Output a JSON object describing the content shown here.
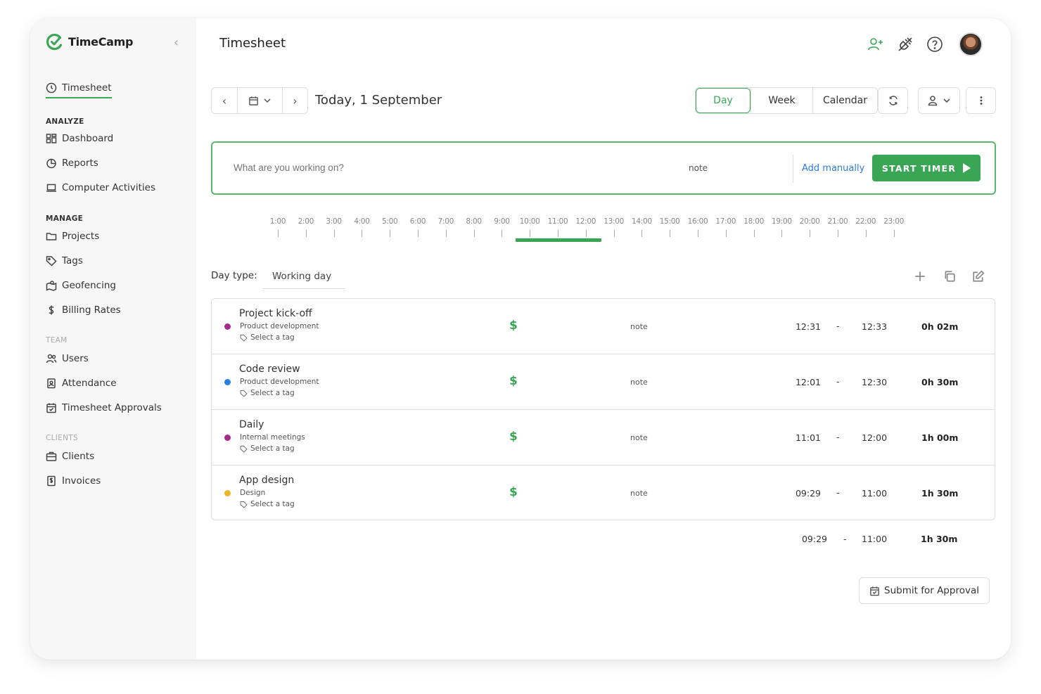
{
  "brand": {
    "name": "TimeCamp",
    "accent": "#3aa655",
    "link_color": "#2a7de1"
  },
  "sidebar": {
    "active_item": "Timesheet",
    "sections": {
      "analyze": "ANALYZE",
      "manage": "MANAGE",
      "team": "TEAM",
      "clients": "CLIENTS"
    },
    "items": {
      "timesheet": "Timesheet",
      "dashboard": "Dashboard",
      "reports": "Reports",
      "computer_activities": "Computer Activities",
      "projects": "Projects",
      "tags": "Tags",
      "geofencing": "Geofencing",
      "billing_rates": "Billing Rates",
      "users": "Users",
      "attendance": "Attendance",
      "timesheet_approvals": "Timesheet Approvals",
      "clients": "Clients",
      "invoices": "Invoices"
    }
  },
  "header": {
    "title": "Timesheet",
    "icons": [
      "add-user-icon",
      "plug-icon",
      "help-icon",
      "avatar"
    ]
  },
  "toolbar": {
    "date_label": "Today, 1 September",
    "views": {
      "day": "Day",
      "week": "Week",
      "calendar": "Calendar"
    },
    "active_view": "Day"
  },
  "entry_bar": {
    "placeholder": "What are you working on?",
    "note": "note",
    "add_manually": "Add manually",
    "start_timer": "START TIMER"
  },
  "timeline": {
    "hours": [
      "1:00",
      "2:00",
      "3:00",
      "4:00",
      "5:00",
      "6:00",
      "7:00",
      "8:00",
      "9:00",
      "10:00",
      "11:00",
      "12:00",
      "13:00",
      "14:00",
      "15:00",
      "16:00",
      "17:00",
      "18:00",
      "19:00",
      "20:00",
      "21:00",
      "22:00",
      "23:00"
    ],
    "tracked_from_hour": 9.48,
    "tracked_to_hour": 12.55
  },
  "day_type": {
    "label": "Day type:",
    "value": "Working day"
  },
  "entries": [
    {
      "title": "Project kick-off",
      "project": "Product development",
      "tag": "Select a tag",
      "color": "#a52a8c",
      "billable": "$",
      "note": "note",
      "start": "12:31",
      "dash": "-",
      "end": "12:33",
      "duration": "0h 02m"
    },
    {
      "title": "Code review",
      "project": "Product development",
      "tag": "Select a tag",
      "color": "#2a7de1",
      "billable": "$",
      "note": "note",
      "start": "12:01",
      "dash": "-",
      "end": "12:30",
      "duration": "0h 30m"
    },
    {
      "title": "Daily",
      "project": "Internal meetings",
      "tag": "Select a tag",
      "color": "#a52a8c",
      "billable": "$",
      "note": "note",
      "start": "11:01",
      "dash": "-",
      "end": "12:00",
      "duration": "1h 00m"
    },
    {
      "title": "App design",
      "project": "Design",
      "tag": "Select a tag",
      "color": "#f0b429",
      "billable": "$",
      "note": "note",
      "start": "09:29",
      "dash": "-",
      "end": "11:00",
      "duration": "1h 30m"
    }
  ],
  "totals": {
    "start": "09:29",
    "dash": "-",
    "end": "11:00",
    "duration": "1h 30m"
  },
  "submit": {
    "label": "Submit for Approval"
  }
}
